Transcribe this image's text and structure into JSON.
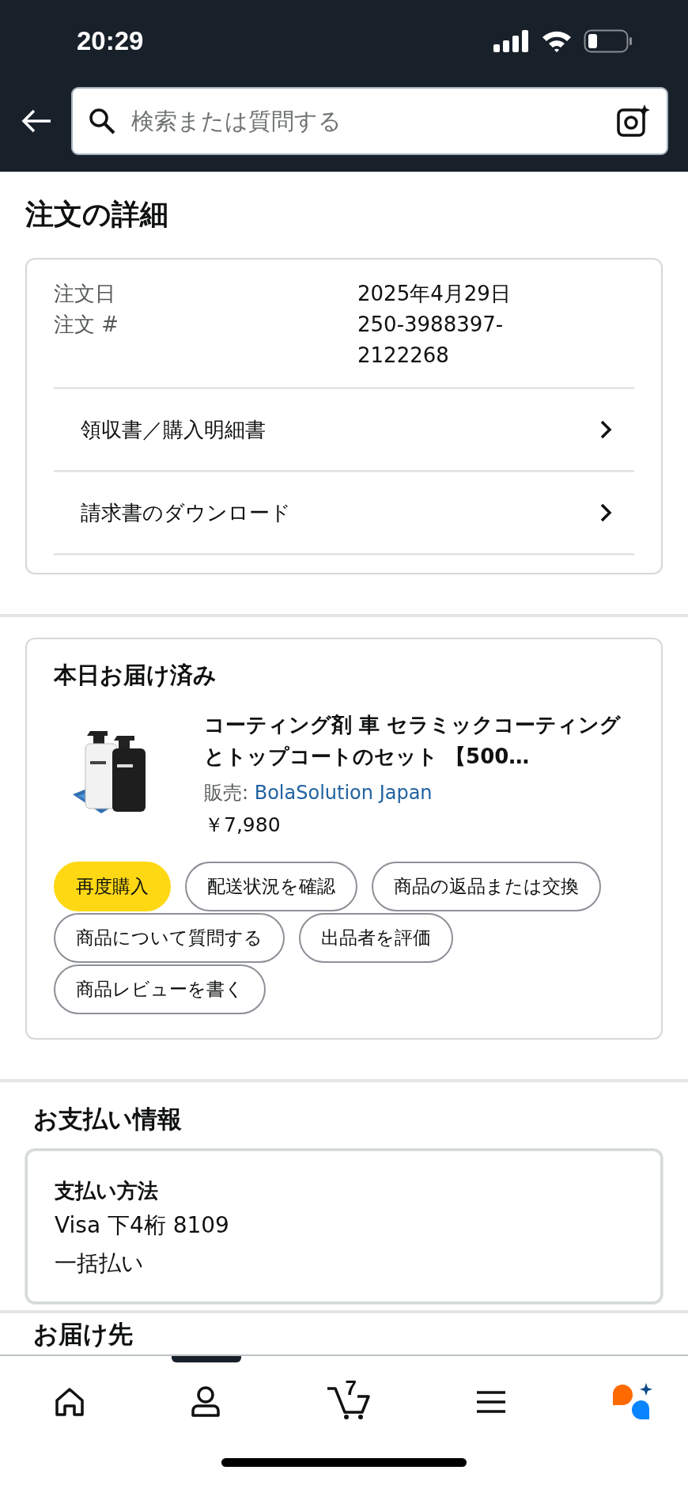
{
  "status_bar": {
    "time": "20:29"
  },
  "search": {
    "placeholder": "検索または質問する"
  },
  "page_title": "注文の詳細",
  "order": {
    "fields": [
      {
        "label": "注文日",
        "value": "2025年4月29日"
      },
      {
        "label": "注文 #",
        "value": "250-3988397-\n2122268"
      }
    ],
    "links": [
      "領収書／購入明細書",
      "請求書のダウンロード"
    ]
  },
  "delivery": {
    "heading": "本日お届け済み",
    "product": {
      "kind": "picture",
      "title": "コーティング剤 車 セラミックコーティングとトップコートのセット 【500…",
      "seller_label": "販売:",
      "seller": "BolaSolution Japan",
      "price": "￥7,980"
    },
    "actions": [
      {
        "label": "再度購入",
        "primary": true
      },
      {
        "label": "配送状況を確認",
        "primary": false
      },
      {
        "label": "商品の返品または交換",
        "primary": false
      },
      {
        "label": "商品について質問する",
        "primary": false
      },
      {
        "label": "出品者を評価",
        "primary": false
      },
      {
        "label": "商品レビューを書く",
        "primary": false
      }
    ]
  },
  "payment": {
    "heading": "お支払い情報",
    "method_label": "支払い方法",
    "lines": [
      "Visa 下4桁 8109",
      "一括払い"
    ]
  },
  "next_heading": "お届け先",
  "nav": {
    "items": [
      {
        "kind": "home"
      },
      {
        "kind": "account"
      },
      {
        "kind": "cart",
        "count": "7"
      },
      {
        "kind": "menu"
      },
      {
        "kind": "assistant"
      }
    ]
  }
}
